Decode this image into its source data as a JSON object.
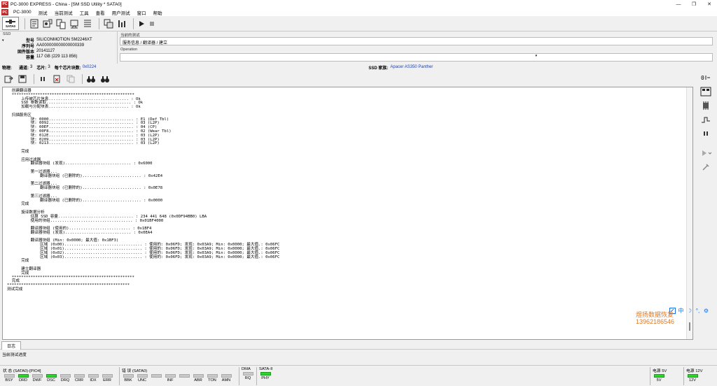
{
  "window": {
    "app_icon_text": "PC",
    "title": "PC-3000 EXPRESS - China - [SM SSD Utility * SATA0]",
    "controls": [
      "—",
      "❐",
      "✕"
    ]
  },
  "menu": [
    "PC-3000",
    "测试",
    "当前测试",
    "工具",
    "查看",
    "用户测试",
    "窗口",
    "帮助"
  ],
  "toolbar": {
    "sata_label": "SATA0"
  },
  "ssd_panel": {
    "header": "SSD",
    "rows": [
      {
        "k": "型号",
        "v": "SILICONMOTION SM2246XT"
      },
      {
        "k": "序列号",
        "v": "AA000000000000000339"
      },
      {
        "k": "固件版本",
        "v": "20141127"
      },
      {
        "k": "容量",
        "v": "117 GB (229 113 856)"
      }
    ]
  },
  "current_test": {
    "header": "当前的测试",
    "value": "服务信息 / 翻译器 / 建立"
  },
  "operation": {
    "header": "Operation",
    "value": "",
    "dropdown": "▾"
  },
  "info": {
    "phys_label": "物理:",
    "channels_label": "通道:",
    "channels": "3",
    "chips_label": "芯片:",
    "chips": "3",
    "blocks_label": "每个芯片块数:",
    "blocks": "0x0224",
    "family_label": "SSD 家族:",
    "family": "Apacer AS350 Panther"
  },
  "log_text": "  创建翻译器\n  ****************************************************\n      上传被芯片信息.................................. : Ok\n      SSD 参数读取.................................... : Ok\n      加载与分配块表.................................. : Ok\n\n  扫描服务区\n          块: 0000.................................... : E1 (Def Tbl)\n          块: 0092.................................... : 03 (L2P)\n          块: 00EF.................................... : 04 (CP)\n          块: 00F8.................................... : 02 (Wear Tbl)\n          块: 012E.................................... : 03 (L2P)\n          块: 0209.................................... : 03 (L2P)\n          块: 0213.................................... : 03 (L2P)\n\n      完成\n\n      应用过滤器\n          翻译器块组 (发现)............................ : 0x6000\n\n          第一过滤器...\n              翻译器块组 (已删除的)......................... : 0x42E4\n\n          第二过滤器...\n              翻译器块组 (已删除的)......................... : 0x0E78\n\n          第三过滤器...\n              翻译器块组 (已删除的)......................... : 0x0000\n      完成\n\n      旋译数据分析\n          估算 SSD 容量................................ : 234 441 648 (0x0DF94BB0) LBA\n          使用的块组................................... : 0x01BF4000\n\n          翻译器块组 (使用的).......................... : 0x1BF4\n          翻译器块组 (发现)............................ : 0x0EA4\n\n          翻译器块组 (Min: 0x0000; 最大值: 0x1BF3)\n              区域 (0x00)................................. : 使用的: 0x06FD; 发现: 0x03A9; Min: 0x0000; 最大值.: 0x06FC\n              区域 (0x01)................................. : 使用的: 0x06FD; 发现: 0x03A9; Min: 0x0000; 最大值.: 0x06FC\n              区域 (0x02)................................. : 使用的: 0x06FD; 发现: 0x03A9; Min: 0x0000; 最大值.: 0x06FC\n              区域 (0x03)................................. : 使用的: 0x06FD; 发现: 0x03A9; Min: 0x0000; 最大值.: 0x06FC\n      完成\n\n      建立翻译器\n      完成\n  ****************************************************\n  完成\n****************************************************\n测试完成",
  "watermark": [
    "煜扬数据恢复",
    "13962186546"
  ],
  "ime": [
    "中",
    "☽",
    "°,",
    "⚙"
  ],
  "tab": "日志",
  "progress_label": "当前测试进度",
  "status_bar": {
    "status_group": {
      "label": "状 态 (SATA0)-[PIO4]",
      "leds": [
        {
          "name": "BSY",
          "on": false
        },
        {
          "name": "DRD",
          "on": true
        },
        {
          "name": "DWF",
          "on": false
        },
        {
          "name": "DSC",
          "on": true
        },
        {
          "name": "DRQ",
          "on": false
        },
        {
          "name": "CRR",
          "on": false
        },
        {
          "name": "IDX",
          "on": false
        },
        {
          "name": "ERR",
          "on": false
        }
      ]
    },
    "error_group": {
      "label": "错 误 (SATA0)",
      "leds": [
        {
          "name": "BBK",
          "on": false
        },
        {
          "name": "UNC",
          "on": false
        },
        {
          "name": "",
          "on": false
        },
        {
          "name": "INF",
          "on": false
        },
        {
          "name": "",
          "on": false
        },
        {
          "name": "ABR",
          "on": false
        },
        {
          "name": "TON",
          "on": false
        },
        {
          "name": "AMN",
          "on": false
        }
      ]
    },
    "dma_group": {
      "label": "DMA",
      "leds": [
        {
          "name": "RQ",
          "on": false
        }
      ]
    },
    "sata_group": {
      "label": "SATA-II",
      "leds": [
        {
          "name": "PHY",
          "on": true
        }
      ]
    },
    "power5": {
      "label": "电源 5V",
      "leds": [
        {
          "name": "5V",
          "on": true
        }
      ]
    },
    "power12": {
      "label": "电源 12V",
      "leds": [
        {
          "name": "12V",
          "on": true
        }
      ]
    }
  },
  "colors": {
    "led_on": "#2fd32f",
    "link_blue": "#1a3fb8",
    "watermark": "#e07820"
  }
}
